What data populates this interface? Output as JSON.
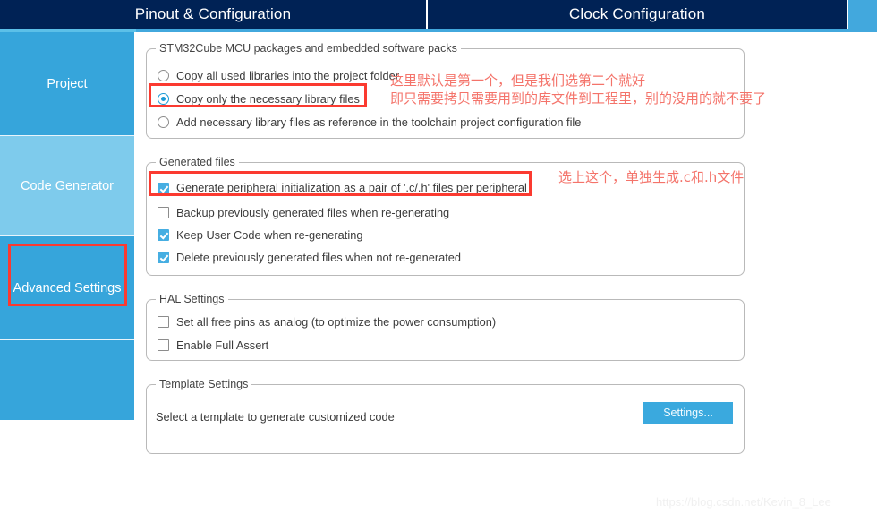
{
  "app": {
    "watermark": "https://blog.csdn.net/Kevin_8_Lee"
  },
  "tabs": [
    {
      "label": "Pinout & Configuration",
      "active": true
    },
    {
      "label": "Clock Configuration",
      "active": false
    }
  ],
  "sidebar": {
    "items": [
      {
        "label": "Project",
        "selected": false
      },
      {
        "label": "Code Generator",
        "selected": true
      },
      {
        "label": "Advanced Settings",
        "selected": false
      },
      {
        "label": "",
        "selected": false
      }
    ]
  },
  "groups": {
    "packs": {
      "title": "STM32Cube MCU packages and embedded software packs",
      "options": [
        {
          "label": "Copy all used libraries into the project folder",
          "checked": false
        },
        {
          "label": "Copy only the necessary library files",
          "checked": true
        },
        {
          "label": "Add necessary library files as reference in the toolchain project configuration file",
          "checked": false
        }
      ]
    },
    "generated_files": {
      "title": "Generated files",
      "options": [
        {
          "label": "Generate peripheral initialization as a pair of '.c/.h' files per peripheral",
          "checked": true,
          "focused": true
        },
        {
          "label": "Backup previously generated files when re-generating",
          "checked": false,
          "focused": false
        },
        {
          "label": "Keep User Code when re-generating",
          "checked": true,
          "focused": false
        },
        {
          "label": "Delete previously generated files when not re-generated",
          "checked": true,
          "focused": false
        }
      ]
    },
    "hal_settings": {
      "title": "HAL Settings",
      "options": [
        {
          "label": "Set all free pins as analog (to optimize the power consumption)",
          "checked": false
        },
        {
          "label": "Enable Full Assert",
          "checked": false
        }
      ]
    },
    "template_settings": {
      "title": "Template Settings",
      "description": "Select a template to generate customized code",
      "button_label": "Settings..."
    }
  },
  "annotations": [
    {
      "line1": "这里默认是第一个，但是我们选第二个就好",
      "line2": "即只需要拷贝需要用到的库文件到工程里，别的没用的就不要了"
    },
    {
      "line1": "选上这个，单独生成.c和.h文件"
    }
  ],
  "colors": {
    "tab_active_bg": "#002255",
    "tab_bar_bg": "#42a8dd",
    "sidebar_item_bg": "#36a5db",
    "sidebar_item_selected_bg": "#7ecbec",
    "accent": "#3aa9de",
    "annotation_red": "#f4736a",
    "highlight_box": "#fb3a30"
  }
}
